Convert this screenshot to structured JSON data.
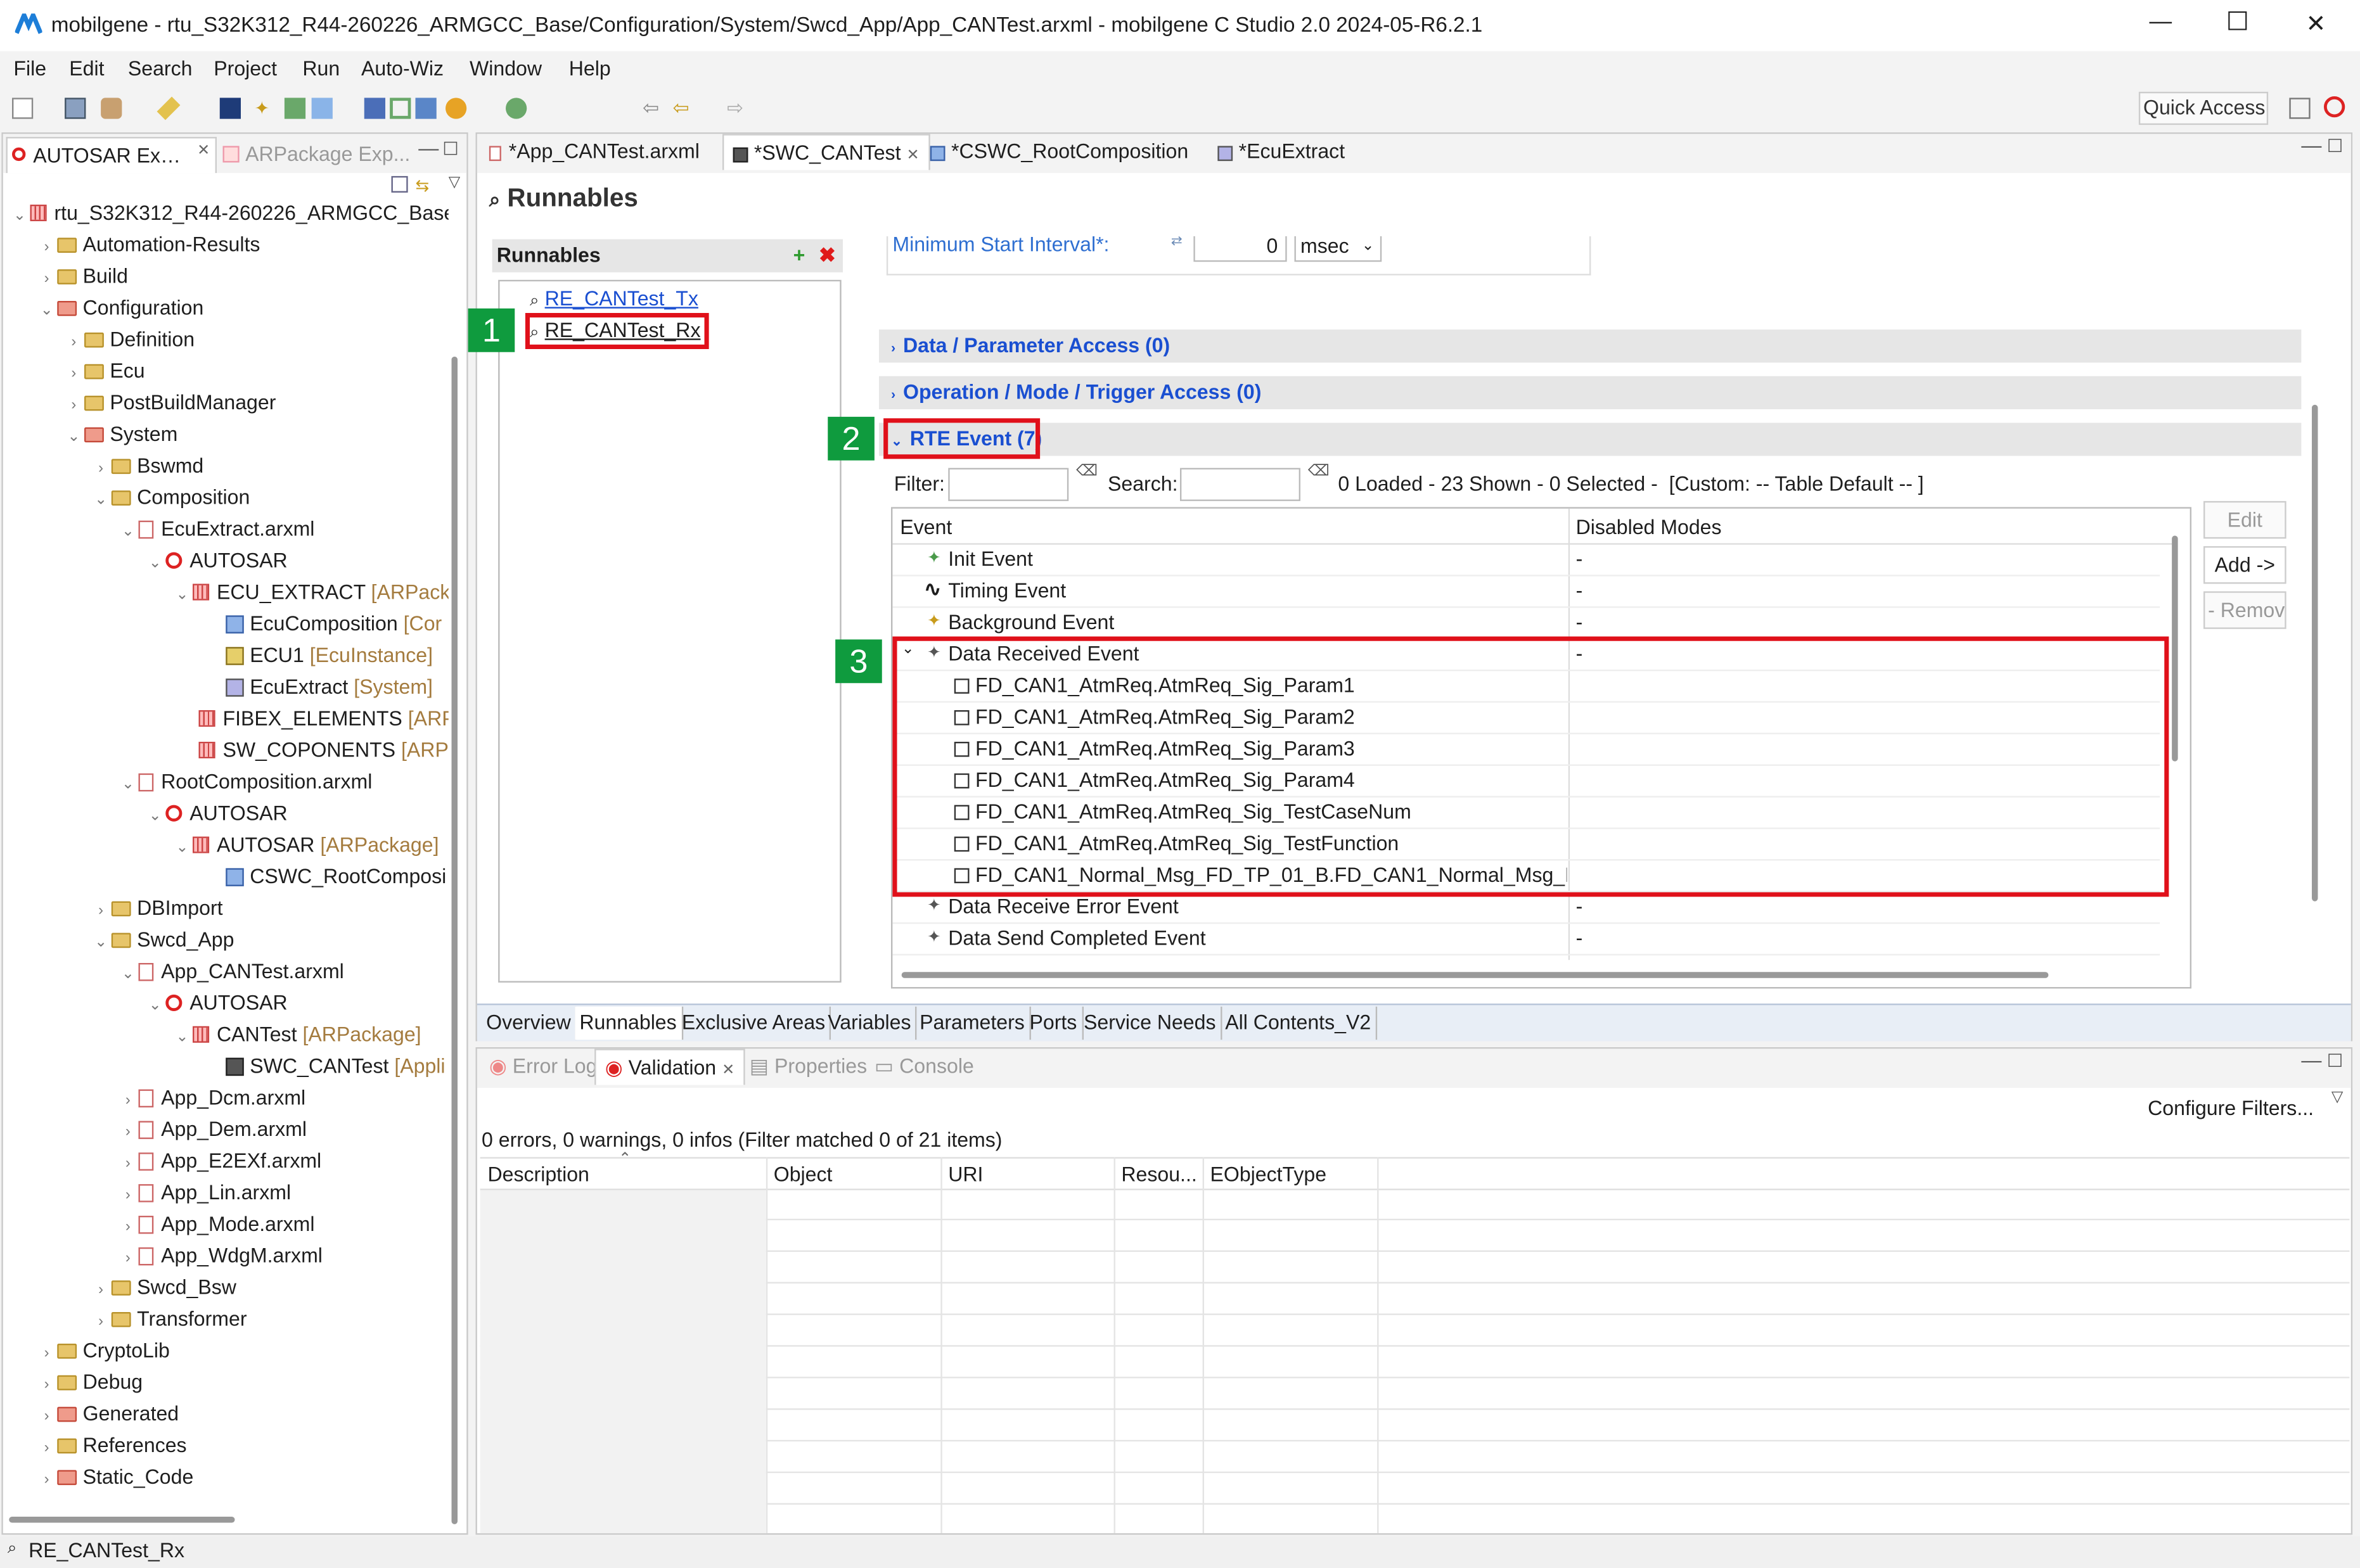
{
  "title_bar": {
    "text": "mobilgene - rtu_S32K312_R44-260226_ARMGCC_Base/Configuration/System/Swcd_App/App_CANTest.arxml - mobilgene C Studio 2.0 2024-05-R6.2.1"
  },
  "window_controls": {
    "minimize": "—",
    "maximize": "☐",
    "close": "✕"
  },
  "menu": [
    "File",
    "Edit",
    "Search",
    "Project",
    "Run",
    "Auto-Wiz",
    "Window",
    "Help"
  ],
  "quick_access": "Quick Access",
  "left_tabs": {
    "tab1": "AUTOSAR Expl...",
    "tab2": "ARPackage Exp..."
  },
  "tree": {
    "root": "rtu_S32K312_R44-260226_ARMGCC_Base",
    "n1": "Automation-Results",
    "n2": "Build",
    "n3": "Configuration",
    "n4": "Definition",
    "n5": "Ecu",
    "n6": "PostBuildManager",
    "n7": "System",
    "n8": "Bswmd",
    "n9": "Composition",
    "n10": "EcuExtract.arxml",
    "n11": "AUTOSAR",
    "n12": "ECU_EXTRACT",
    "n12t": "[ARPacka",
    "n13": "EcuComposition",
    "n13t": "[Cor",
    "n14": "ECU1",
    "n14t": "[EcuInstance]",
    "n15": "EcuExtract",
    "n15t": "[System]",
    "n16": "FIBEX_ELEMENTS",
    "n16t": "[ARPa",
    "n17": "SW_COPONENTS",
    "n17t": "[ARPa",
    "n18": "RootComposition.arxml",
    "n19": "AUTOSAR",
    "n20": "AUTOSAR",
    "n20t": "[ARPackage]",
    "n21": "CSWC_RootComposi",
    "n22": "DBImport",
    "n23": "Swcd_App",
    "n24": "App_CANTest.arxml",
    "n25": "AUTOSAR",
    "n26": "CANTest",
    "n26t": "[ARPackage]",
    "n27": "SWC_CANTest",
    "n27t": "[Appli",
    "n28": "App_Dcm.arxml",
    "n29": "App_Dem.arxml",
    "n30": "App_E2EXf.arxml",
    "n31": "App_Lin.arxml",
    "n32": "App_Mode.arxml",
    "n33": "App_WdgM.arxml",
    "n34": "Swcd_Bsw",
    "n35": "Transformer",
    "n36": "CryptoLib",
    "n37": "Debug",
    "n38": "Generated",
    "n39": "References",
    "n40": "Static_Code"
  },
  "editor_tabs": {
    "t1": "*App_CANTest.arxml",
    "t2": "*SWC_CANTest",
    "t3": "*CSWC_RootComposition",
    "t4": "*EcuExtract"
  },
  "page": {
    "title": "Runnables"
  },
  "runnables": {
    "header": "Runnables",
    "items": [
      "RE_CANTest_Tx",
      "RE_CANTest_Rx"
    ]
  },
  "min_start": {
    "label": "Minimum Start Interval*:",
    "value": "0",
    "unit": "msec"
  },
  "sections": {
    "data_param": "Data / Parameter Access (0)",
    "operation": "Operation / Mode / Trigger Access (0)",
    "rte_event": "RTE Event (7)"
  },
  "filter": {
    "filter_label": "Filter:",
    "search_label": "Search:",
    "status": "0 Loaded - 23 Shown - 0 Selected -  [Custom: -- Table Default -- ]"
  },
  "buttons": {
    "edit": "Edit",
    "add": "Add ->",
    "remove": "- Remov"
  },
  "event_table": {
    "col1": "Event",
    "col2": "Disabled Modes",
    "rows": [
      {
        "name": "Init Event",
        "modes": "-"
      },
      {
        "name": "Timing Event",
        "modes": "-"
      },
      {
        "name": "Background Event",
        "modes": "-"
      },
      {
        "name": "Data Received Event",
        "modes": "-"
      },
      {
        "name": "FD_CAN1_AtmReq.AtmReq_Sig_Param1",
        "modes": ""
      },
      {
        "name": "FD_CAN1_AtmReq.AtmReq_Sig_Param2",
        "modes": ""
      },
      {
        "name": "FD_CAN1_AtmReq.AtmReq_Sig_Param3",
        "modes": ""
      },
      {
        "name": "FD_CAN1_AtmReq.AtmReq_Sig_Param4",
        "modes": ""
      },
      {
        "name": "FD_CAN1_AtmReq.AtmReq_Sig_TestCaseNum",
        "modes": ""
      },
      {
        "name": "FD_CAN1_AtmReq.AtmReq_Sig_TestFunction",
        "modes": ""
      },
      {
        "name": "FD_CAN1_Normal_Msg_FD_TP_01_B.FD_CAN1_Normal_Msg_FD_",
        "modes": ""
      },
      {
        "name": "Data Receive Error Event",
        "modes": "-"
      },
      {
        "name": "Data Send Completed Event",
        "modes": "-"
      }
    ]
  },
  "bottom_editor_tabs": [
    "Overview",
    "Runnables",
    "Exclusive Areas",
    "Variables",
    "Parameters",
    "Ports",
    "Service Needs",
    "All Contents_V2"
  ],
  "views": {
    "t1": "Error Log",
    "t2": "Validation",
    "t3": "Properties",
    "t4": "Console"
  },
  "validation": {
    "configure": "Configure Filters...",
    "summary": "0 errors, 0 warnings, 0 infos (Filter matched 0 of 21 items)",
    "cols": [
      "Description",
      "Object",
      "URI",
      "Resou...",
      "EObjectType"
    ]
  },
  "status_bar": {
    "text": "RE_CANTest_Rx"
  },
  "annotations": [
    "1",
    "2",
    "3"
  ],
  "colors": {
    "accent": "#1a4fd1",
    "highlight": "#e0101a",
    "badge": "#0f9b3e"
  }
}
